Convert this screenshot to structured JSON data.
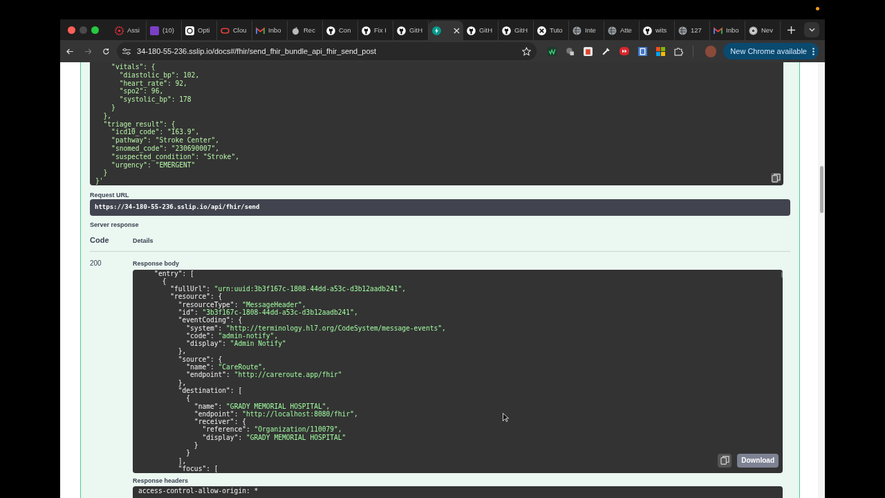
{
  "browser": {
    "tabs": [
      {
        "label": "Assi",
        "kind": "sunburst",
        "selected": false
      },
      {
        "label": "(10)",
        "kind": "square",
        "selected": false
      },
      {
        "label": "Opti",
        "kind": "knot",
        "selected": false
      },
      {
        "label": "Clou",
        "kind": "ring",
        "selected": false
      },
      {
        "label": "Inbo",
        "kind": "mail",
        "selected": false
      },
      {
        "label": "Rec",
        "kind": "apple",
        "selected": false
      },
      {
        "label": "Con",
        "kind": "cat",
        "selected": false
      },
      {
        "label": "Fix I",
        "kind": "cat",
        "selected": false
      },
      {
        "label": "GitH",
        "kind": "cat",
        "selected": false
      },
      {
        "kind": "bolt",
        "selected": true
      },
      {
        "label": "GitH",
        "kind": "cat",
        "selected": false
      },
      {
        "label": "GitH",
        "kind": "cat",
        "selected": false
      },
      {
        "label": "Tuto",
        "kind": "cross",
        "selected": false
      },
      {
        "label": "Inte",
        "kind": "globe",
        "selected": false
      },
      {
        "label": "Atte",
        "kind": "globe",
        "selected": false
      },
      {
        "label": "wits",
        "kind": "cat",
        "selected": false
      },
      {
        "label": "127",
        "kind": "globe",
        "selected": false
      },
      {
        "label": "Inbo",
        "kind": "mail",
        "selected": false
      },
      {
        "label": "Nev",
        "kind": "wheel",
        "selected": false
      }
    ],
    "address": "34-180-55-236.sslip.io/docs#/fhir/send_fhir_bundle_api_fhir_send_post",
    "update_button": "New Chrome available"
  },
  "request_body": {
    "kind": "plain",
    "lines": [
      "    \"vitals\": {",
      "      \"diastolic_bp\": 102,",
      "      \"heart_rate\": 92,",
      "      \"spo2\": 96,",
      "      \"systolic_bp\": 178",
      "    }",
      "  },",
      "  \"triage_result\": {",
      "    \"icd10_code\": \"I63.9\",",
      "    \"pathway\": \"Stroke Center\",",
      "    \"snomed_code\": \"230690007\",",
      "    \"suspected_condition\": \"Stroke\",",
      "    \"urgency\": \"EMERGENT\"",
      "  }",
      "}'"
    ]
  },
  "request_url": {
    "label": "Request URL",
    "value": "https://34-180-55-236.sslip.io/api/fhir/send"
  },
  "server_response": {
    "label": "Server response",
    "columns": [
      "Code",
      "Details"
    ],
    "code": "200",
    "body_label": "Response body",
    "body": {
      "kind": "highlighted",
      "lines": [
        "    \"entry\": [",
        "      {",
        "        \"fullUrl\": \"urn:uuid:3b3f167c-1808-44dd-a53c-d3b12aadb241\",",
        "        \"resource\": {",
        "          \"resourceType\": \"MessageHeader\",",
        "          \"id\": \"3b3f167c-1808-44dd-a53c-d3b12aadb241\",",
        "          \"eventCoding\": {",
        "            \"system\": \"http://terminology.hl7.org/CodeSystem/message-events\",",
        "            \"code\": \"admin-notify\",",
        "            \"display\": \"Admin Notify\"",
        "          },",
        "          \"source\": {",
        "            \"name\": \"CareRoute\",",
        "            \"endpoint\": \"http://careroute.app/fhir\"",
        "          },",
        "          \"destination\": [",
        "            {",
        "              \"name\": \"GRADY MEMORIAL HOSPITAL\",",
        "              \"endpoint\": \"http://localhost:8080/fhir\",",
        "              \"receiver\": {",
        "                \"reference\": \"Organization/110079\",",
        "                \"display\": \"GRADY MEMORIAL HOSPITAL\"",
        "              }",
        "            }",
        "          ],",
        "          \"focus\": ["
      ]
    },
    "download": "Download",
    "headers_label": "Response headers",
    "header_lines": [
      "access-control-allow-origin: *"
    ]
  }
}
